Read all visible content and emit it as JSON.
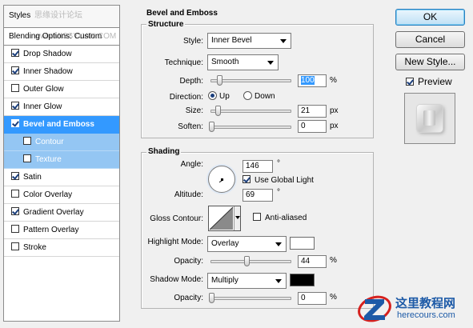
{
  "watermark": "思缘设计论坛 www.MISSYUAN.COM",
  "styles_panel": {
    "header": "Styles",
    "items": [
      {
        "label": "Blending Options: Custom",
        "checkbox": false,
        "checked": false,
        "state": "header"
      },
      {
        "label": "Drop Shadow",
        "checkbox": true,
        "checked": true,
        "state": "normal"
      },
      {
        "label": "Inner Shadow",
        "checkbox": true,
        "checked": true,
        "state": "normal"
      },
      {
        "label": "Outer Glow",
        "checkbox": true,
        "checked": false,
        "state": "normal"
      },
      {
        "label": "Inner Glow",
        "checkbox": true,
        "checked": true,
        "state": "normal"
      },
      {
        "label": "Bevel and Emboss",
        "checkbox": true,
        "checked": true,
        "state": "active"
      },
      {
        "label": "Contour",
        "checkbox": true,
        "checked": false,
        "state": "sub"
      },
      {
        "label": "Texture",
        "checkbox": true,
        "checked": false,
        "state": "sub"
      },
      {
        "label": "Satin",
        "checkbox": true,
        "checked": true,
        "state": "normal"
      },
      {
        "label": "Color Overlay",
        "checkbox": true,
        "checked": false,
        "state": "normal"
      },
      {
        "label": "Gradient Overlay",
        "checkbox": true,
        "checked": true,
        "state": "normal"
      },
      {
        "label": "Pattern Overlay",
        "checkbox": true,
        "checked": false,
        "state": "normal"
      },
      {
        "label": "Stroke",
        "checkbox": true,
        "checked": false,
        "state": "normal"
      }
    ]
  },
  "bevel": {
    "title": "Bevel and Emboss",
    "structure": {
      "title": "Structure",
      "style_label": "Style:",
      "style_value": "Inner Bevel",
      "technique_label": "Technique:",
      "technique_value": "Smooth",
      "depth_label": "Depth:",
      "depth_value": "100",
      "depth_unit": "%",
      "depth_slider": 0.1,
      "direction_label": "Direction:",
      "direction_up": "Up",
      "direction_down": "Down",
      "direction_selected": "Up",
      "size_label": "Size:",
      "size_value": "21",
      "size_unit": "px",
      "size_slider": 0.08,
      "soften_label": "Soften:",
      "soften_value": "0",
      "soften_unit": "px",
      "soften_slider": 0.0
    },
    "shading": {
      "title": "Shading",
      "angle_label": "Angle:",
      "angle_value": "146",
      "angle_unit": "°",
      "use_global_light": "Use Global Light",
      "use_global_light_checked": true,
      "altitude_label": "Altitude:",
      "altitude_value": "69",
      "altitude_unit": "°",
      "gloss_contour_label": "Gloss Contour:",
      "anti_aliased": "Anti-aliased",
      "anti_aliased_checked": false,
      "highlight_mode_label": "Highlight Mode:",
      "highlight_mode_value": "Overlay",
      "highlight_color": "#ffffff",
      "highlight_opacity_label": "Opacity:",
      "highlight_opacity_value": "44",
      "highlight_opacity_unit": "%",
      "highlight_opacity_slider": 0.44,
      "shadow_mode_label": "Shadow Mode:",
      "shadow_mode_value": "Multiply",
      "shadow_color": "#000000",
      "shadow_opacity_label": "Opacity:",
      "shadow_opacity_value": "0",
      "shadow_opacity_unit": "%",
      "shadow_opacity_slider": 0.0
    }
  },
  "buttons": {
    "ok": "OK",
    "cancel": "Cancel",
    "new_style": "New Style...",
    "preview": "Preview",
    "preview_checked": true
  },
  "logo": {
    "chinese": "这里教程网",
    "url": "herecours.com"
  },
  "colors": {
    "accent": "#3399ff",
    "sub_selected": "#94c6f3",
    "logo_blue": "#1d5aa7",
    "logo_red": "#d6211e"
  }
}
